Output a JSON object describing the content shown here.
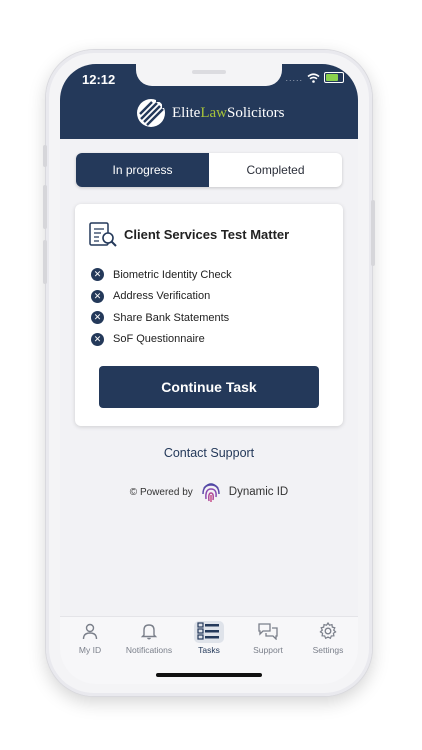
{
  "status_bar": {
    "time": "12:12",
    "signal": "....."
  },
  "header": {
    "brand_part1": "Elite",
    "brand_part2": "Law",
    "brand_part3": "Solicitors"
  },
  "tabs": [
    {
      "label": "In progress",
      "active": true
    },
    {
      "label": "Completed",
      "active": false
    }
  ],
  "matter": {
    "title": "Client Services Test Matter",
    "tasks": [
      {
        "label": "Biometric Identity Check",
        "status_icon": "x-circle-icon"
      },
      {
        "label": "Address Verification",
        "status_icon": "x-circle-icon"
      },
      {
        "label": "Share Bank Statements",
        "status_icon": "x-circle-icon"
      },
      {
        "label": "SoF Questionnaire",
        "status_icon": "x-circle-icon"
      }
    ],
    "continue_label": "Continue Task"
  },
  "support": {
    "label": "Contact Support"
  },
  "powered": {
    "prefix": "© Powered by",
    "brand": "Dynamic ID"
  },
  "nav": [
    {
      "label": "My ID",
      "icon": "person-icon"
    },
    {
      "label": "Notifications",
      "icon": "bell-icon"
    },
    {
      "label": "Tasks",
      "icon": "tasks-icon",
      "active": true
    },
    {
      "label": "Support",
      "icon": "chat-icon"
    },
    {
      "label": "Settings",
      "icon": "gear-icon"
    }
  ],
  "colors": {
    "primary": "#24395a",
    "accent": "#a7c43a",
    "background": "#f2f2f5"
  }
}
